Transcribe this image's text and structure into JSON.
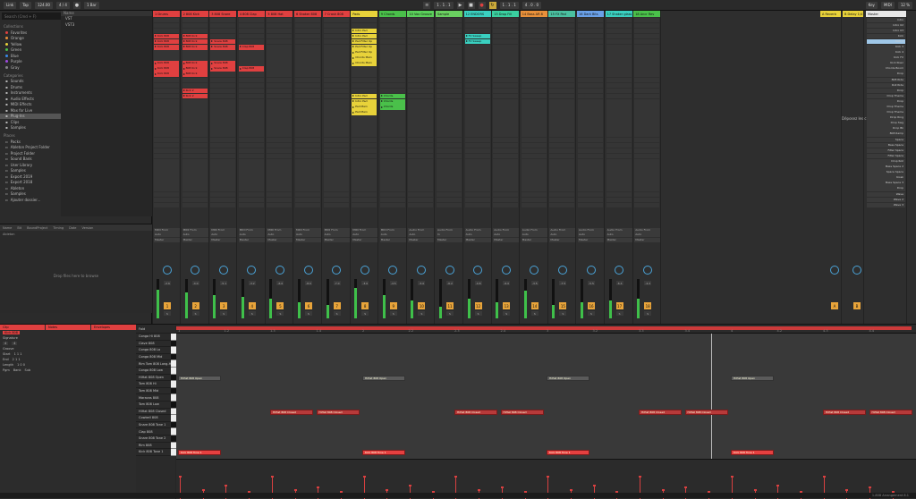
{
  "topbar": {
    "link_label": "Link",
    "tap_label": "Tap",
    "tempo": "124.00",
    "time_sig": "4 / 4",
    "quantize": "1 Bar",
    "position": "1 . 1 . 1",
    "loop_start": "1 . 1 . 1",
    "loop_len": "4 . 0 . 0",
    "key_label": "Key",
    "midi_label": "MIDI",
    "cpu": "12 %"
  },
  "browser": {
    "search_placeholder": "Search (Cmd + F)",
    "collections_title": "Collections",
    "collections": [
      {
        "label": "Favorites",
        "color": "#e04040"
      },
      {
        "label": "Orange",
        "color": "#e8903a"
      },
      {
        "label": "Yellow",
        "color": "#e8d23a"
      },
      {
        "label": "Green",
        "color": "#4ac04a"
      },
      {
        "label": "Blue",
        "color": "#3a8ae8"
      },
      {
        "label": "Purple",
        "color": "#a04ae0"
      },
      {
        "label": "Gray",
        "color": "#888888"
      }
    ],
    "categories_title": "Categories",
    "categories": [
      "Sounds",
      "Drums",
      "Instruments",
      "Audio Effects",
      "MIDI Effects",
      "Max for Live",
      "Plug-Ins",
      "Clips",
      "Samples"
    ],
    "categories_selected": "Plug-Ins",
    "places_title": "Places",
    "places": [
      "Packs",
      "Ableton Project Folder",
      "Project Folder",
      "Sound Bank",
      "User Library",
      "Samples",
      "Export 2019",
      "Export 2018",
      "Ableton",
      "Samples",
      "Ajouter dossier..."
    ],
    "right_header": "Name",
    "right_items": [
      "VST",
      "VST3"
    ],
    "files_header": [
      "Name",
      "Bit",
      "BoundProject",
      "Timing",
      "Date",
      "Version"
    ],
    "files_row": "Ableton",
    "files_msg": "Drop files here to browse"
  },
  "tracks": [
    {
      "name": "1 Drums",
      "color": "#e04040",
      "clips": [
        "",
        "",
        "",
        "Kick 808",
        "Kick 808",
        "Kick 808",
        "",
        "",
        "Kick 808",
        "Kick 808",
        "Kick 808",
        "",
        "",
        "",
        "",
        "",
        "",
        "",
        "",
        "",
        "",
        "",
        "",
        "",
        "",
        "",
        "",
        "",
        "",
        "",
        "",
        "",
        "",
        "",
        ""
      ],
      "input": "MIDI From",
      "mon": "Auto",
      "out": "Master",
      "vol": "-2.6",
      "meter": 0.72
    },
    {
      "name": "2 808 Kick",
      "color": "#e04040",
      "clips": [
        "",
        "",
        "",
        "808 Kick",
        "808 Kick",
        "808 Kick",
        "",
        "",
        "808 Kick",
        "808 Kick",
        "808 Kick",
        "",
        "",
        "Kick 2",
        "Kick 2",
        "",
        "",
        "",
        "",
        "",
        "",
        "",
        "",
        "",
        "",
        "",
        "",
        "",
        "",
        "",
        "",
        "",
        "",
        "",
        ""
      ],
      "input": "MIDI From",
      "mon": "Auto",
      "out": "Master",
      "vol": "-4.0",
      "meter": 0.65
    },
    {
      "name": "3 808 Snare",
      "color": "#e04040",
      "clips": [
        "",
        "",
        "",
        "",
        "Snare 808",
        "Snare 808",
        "",
        "",
        "Snare 808",
        "Snare 808",
        "",
        "",
        "",
        "",
        "",
        "",
        "",
        "",
        "",
        "",
        "",
        "",
        "",
        "",
        "",
        "",
        "",
        "",
        "",
        "",
        "",
        "",
        "",
        "",
        ""
      ],
      "input": "MIDI From",
      "mon": "Auto",
      "out": "Master",
      "vol": "-5.1",
      "meter": 0.6
    },
    {
      "name": "4 808 Clap",
      "color": "#e04040",
      "clips": [
        "",
        "",
        "",
        "",
        "",
        "Clap 808",
        "",
        "",
        "",
        "Clap 808",
        "",
        "",
        "",
        "",
        "",
        "",
        "",
        "",
        "",
        "",
        "",
        "",
        "",
        "",
        "",
        "",
        "",
        "",
        "",
        "",
        "",
        "",
        "",
        "",
        ""
      ],
      "input": "MIDI From",
      "mon": "Auto",
      "out": "Master",
      "vol": "-3.2",
      "meter": 0.55
    },
    {
      "name": "5 808 Hat",
      "color": "#e04040",
      "clips": [
        "",
        "",
        "",
        "",
        "",
        "",
        "",
        "",
        "",
        "",
        "",
        "",
        "",
        "",
        "",
        "",
        "",
        "",
        "",
        "",
        "",
        "",
        "",
        "",
        "",
        "",
        "",
        "",
        "",
        "",
        "",
        "",
        "",
        "",
        ""
      ],
      "input": "MIDI From",
      "mon": "Auto",
      "out": "Master",
      "vol": "-6.0",
      "meter": 0.5
    },
    {
      "name": "6 Shaker 808",
      "color": "#e04040",
      "clips": [
        "",
        "",
        "",
        "",
        "",
        "",
        "",
        "",
        "",
        "",
        "",
        "",
        "",
        "",
        "",
        "",
        "",
        "",
        "",
        "",
        "",
        "",
        "",
        "",
        "",
        "",
        "",
        "",
        "",
        "",
        "",
        "",
        "",
        "",
        ""
      ],
      "input": "MIDI From",
      "mon": "Auto",
      "out": "Master",
      "vol": "-8.0",
      "meter": 0.4
    },
    {
      "name": "7 Crash 808",
      "color": "#e04040",
      "clips": [
        "",
        "",
        "",
        "",
        "",
        "",
        "",
        "",
        "",
        "",
        "",
        "",
        "",
        "",
        "",
        "",
        "",
        "",
        "",
        "",
        "",
        "",
        "",
        "",
        "",
        "",
        "",
        "",
        "",
        "",
        "",
        "",
        "",
        "",
        ""
      ],
      "input": "MIDI From",
      "mon": "Auto",
      "out": "Master",
      "vol": "-7.0",
      "meter": 0.35
    },
    {
      "name": "Pads",
      "color": "#e8d23a",
      "clips": [
        "",
        "",
        "Intro Pad",
        "Intro Pad",
        "Pad Filter Up",
        "Pad Filter Up",
        "Pad Filter Up",
        "Chords Main",
        "Chords Main",
        "",
        "",
        "",
        "",
        "",
        "Intro Pad",
        "Intro Pad",
        "Pad Main",
        "Pad Main",
        "",
        "",
        "",
        "",
        "",
        "",
        "",
        "",
        "",
        "",
        "",
        "",
        "",
        "",
        "",
        "",
        ""
      ],
      "input": "MIDI From",
      "mon": "Auto",
      "out": "Master",
      "vol": "-3.0",
      "meter": 0.78
    },
    {
      "name": "9 Chords",
      "color": "#4ac04a",
      "clips": [
        "",
        "",
        "",
        "",
        "",
        "",
        "",
        "",
        "",
        "",
        "",
        "",
        "",
        "",
        "Chords",
        "Chords",
        "Chords",
        "",
        "",
        "",
        "",
        "",
        "",
        "",
        "",
        "",
        "",
        "",
        "",
        "",
        "",
        "",
        "",
        "",
        ""
      ],
      "input": "MIDI From",
      "mon": "Auto",
      "out": "Master",
      "vol": "-4.5",
      "meter": 0.6
    },
    {
      "name": "10 Vox Groove",
      "color": "#5ad05a",
      "clips": [
        "",
        "",
        "",
        "",
        "",
        "",
        "",
        "",
        "",
        "",
        "",
        "",
        "",
        "",
        "",
        "",
        "",
        "",
        "",
        "",
        "",
        "",
        "",
        "",
        "",
        "",
        "",
        "",
        "",
        "",
        "",
        "",
        "",
        "",
        ""
      ],
      "input": "Audio From",
      "mon": "Auto",
      "out": "Master",
      "vol": "-5.0",
      "meter": 0.45
    },
    {
      "name": "Sample",
      "color": "#6ad060",
      "clips": [
        "",
        "",
        "",
        "",
        "",
        "",
        "",
        "",
        "",
        "",
        "",
        "",
        "",
        "",
        "",
        "",
        "",
        "",
        "",
        "",
        "",
        "",
        "",
        "",
        "",
        "",
        "",
        "",
        "",
        "",
        "",
        "",
        "",
        "",
        ""
      ],
      "input": "Audio From",
      "mon": "In",
      "out": "Master",
      "vol": "-6.2",
      "meter": 0.3
    },
    {
      "name": "12 ENDORS",
      "color": "#3ad0c0",
      "clips": [
        "",
        "",
        "",
        "FX Sweep",
        "FX Sweep",
        "",
        "",
        "",
        "",
        "",
        "",
        "",
        "",
        "",
        "",
        "",
        "",
        "",
        "",
        "",
        "",
        "",
        "",
        "",
        "",
        "",
        "",
        "",
        "",
        "",
        "",
        "",
        "",
        "",
        ""
      ],
      "input": "Audio From",
      "mon": "Auto",
      "out": "Master",
      "vol": "-4.8",
      "meter": 0.5
    },
    {
      "name": "13 Drop Fill",
      "color": "#3ad0a0",
      "clips": [
        "",
        "",
        "",
        "",
        "",
        "",
        "",
        "",
        "",
        "",
        "",
        "",
        "",
        "",
        "",
        "",
        "",
        "",
        "",
        "",
        "",
        "",
        "",
        "",
        "",
        "",
        "",
        "",
        "",
        "",
        "",
        "",
        "",
        "",
        ""
      ],
      "input": "Audio From",
      "mon": "Auto",
      "out": "Master",
      "vol": "-6.0",
      "meter": 0.4
    },
    {
      "name": "14 Bass AR 8",
      "color": "#e8903a",
      "clips": [
        "",
        "",
        "",
        "",
        "",
        "",
        "",
        "",
        "",
        "",
        "",
        "",
        "",
        "",
        "",
        "",
        "",
        "",
        "",
        "",
        "",
        "",
        "",
        "",
        "",
        "",
        "",
        "",
        "",
        "",
        "",
        "",
        "",
        "",
        ""
      ],
      "input": "Audio From",
      "mon": "Auto",
      "out": "Master",
      "vol": "-3.5",
      "meter": 0.7
    },
    {
      "name": "15 FX Pad",
      "color": "#4ac0a0",
      "clips": [
        "",
        "",
        "",
        "",
        "",
        "",
        "",
        "",
        "",
        "",
        "",
        "",
        "",
        "",
        "",
        "",
        "",
        "",
        "",
        "",
        "",
        "",
        "",
        "",
        "",
        "",
        "",
        "",
        "",
        "",
        "",
        "",
        "",
        "",
        ""
      ],
      "input": "Audio From",
      "mon": "Auto",
      "out": "Master",
      "vol": "-7.5",
      "meter": 0.35
    },
    {
      "name": "16 Dark Bits",
      "color": "#6aa0e8",
      "clips": [
        "",
        "",
        "",
        "",
        "",
        "",
        "",
        "",
        "",
        "",
        "",
        "",
        "",
        "",
        "",
        "",
        "",
        "",
        "",
        "",
        "",
        "",
        "",
        "",
        "",
        "",
        "",
        "",
        "",
        "",
        "",
        "",
        "",
        "",
        ""
      ],
      "input": "Audio From",
      "mon": "Auto",
      "out": "Master",
      "vol": "-5.5",
      "meter": 0.4
    },
    {
      "name": "17 Shaker glass",
      "color": "#3ad0c0",
      "clips": [
        "",
        "",
        "",
        "",
        "",
        "",
        "",
        "",
        "",
        "",
        "",
        "",
        "",
        "",
        "",
        "",
        "",
        "",
        "",
        "",
        "",
        "",
        "",
        "",
        "",
        "",
        "",
        "",
        "",
        "",
        "",
        "",
        "",
        "",
        ""
      ],
      "input": "Audio From",
      "mon": "Auto",
      "out": "Master",
      "vol": "-6.4",
      "meter": 0.45
    },
    {
      "name": "18 Ancr Rev",
      "color": "#4ac04a",
      "clips": [
        "",
        "",
        "",
        "",
        "",
        "",
        "",
        "",
        "",
        "",
        "",
        "",
        "",
        "",
        "",
        "",
        "",
        "",
        "",
        "",
        "",
        "",
        "",
        "",
        "",
        "",
        "",
        "",
        "",
        "",
        "",
        "",
        "",
        "",
        ""
      ],
      "input": "Audio From",
      "mon": "Auto",
      "out": "Master",
      "vol": "-4.2",
      "meter": 0.5
    }
  ],
  "returns": [
    {
      "name": "A Reverb",
      "color": "#e8d23a",
      "out": "Master",
      "vol": "0"
    },
    {
      "name": "B Delay 1/4",
      "color": "#e8d23a",
      "out": "Master",
      "vol": "0"
    }
  ],
  "master": {
    "name": "Master",
    "color": "#e8e8e8",
    "scenes": [
      "Intro",
      "Intro 02",
      "Intro 03",
      "Kick",
      "Kick 2",
      "Kick 3",
      "Kick 4",
      "Kick FX",
      "Kick Riser",
      "Chords Boom",
      "Drop",
      "808 Ride",
      "Roll Ride",
      "Drop",
      "Drop Theme",
      "Drop",
      "Drop Theme",
      "Drop Theme",
      "Drop Ring",
      "Drop Swg",
      "Drop Bk",
      "808 Ramp",
      "Space",
      "Bass Space",
      "Filter Space",
      "Filter Space",
      "Drop Roll",
      "Bass Space 2",
      "Space Space",
      "Kiosk",
      "Bass Space 3",
      "Drop",
      "Wave",
      "Wave 2",
      "Wave 3"
    ],
    "cue": "Cue Out",
    "out": "Master Out",
    "vol": "0"
  },
  "session_msg": "Déposez les clips et périphériques",
  "clip_view": {
    "clip_title": "Clip",
    "clip_name": "Kick 808",
    "signature_label": "Signature",
    "sig_num": "4",
    "sig_den": "4",
    "groove_label": "Groove",
    "notes_title": "Notes",
    "start_label": "Start",
    "end_label": "End",
    "length_label": "Length",
    "start_val": "1 1 1",
    "end_val": "2 1 1",
    "length_val": "1 0 0",
    "pgm_label": "Pgm",
    "bank_label": "Bank",
    "sub_label": "Sub",
    "envelopes_title": "Envelopes"
  },
  "piano_roll": {
    "fold_label": "Fold",
    "rows": [
      "Conga Hi 808",
      "Clave 808",
      "Conga 808 Lo",
      "Conga 808 Mid",
      "Rim Tom 808 Long-Hi",
      "Conga 808 Low",
      "HiHat 808 Open",
      "Tom 808 Hi",
      "Tom 808 Mid",
      "Maracas 808",
      "Tom 808 Low",
      "HiHat 808 Closed",
      "Cowbell 808",
      "Snare 808 Tone 1",
      "Clap 808",
      "Snare 808 Tone 2",
      "Rim 808",
      "Kick 808 Tone 1"
    ],
    "ruler": [
      "1",
      "1.2",
      "1.3",
      "1.4",
      "2",
      "2.2",
      "2.3",
      "2.4",
      "3",
      "3.2",
      "3.3",
      "3.4",
      "4",
      "4.2",
      "4.3",
      "4.4"
    ],
    "note_open": "HiHat 808 Open",
    "note_closed": "HiHat 808 Closed",
    "note_kick": "Kick 808 Tone 1",
    "velocities": [
      0.6,
      0.25,
      0.35,
      0.2,
      0.6,
      0.25,
      0.3,
      0.2,
      0.6,
      0.25,
      0.35,
      0.2,
      0.6,
      0.25,
      0.3,
      0.2,
      0.6,
      0.25,
      0.35,
      0.2,
      0.6,
      0.25,
      0.3,
      0.2,
      0.6,
      0.25,
      0.35,
      0.2,
      0.6,
      0.25,
      0.3,
      0.2
    ]
  },
  "status": {
    "right": "1-808 Arrangement 8.1"
  }
}
